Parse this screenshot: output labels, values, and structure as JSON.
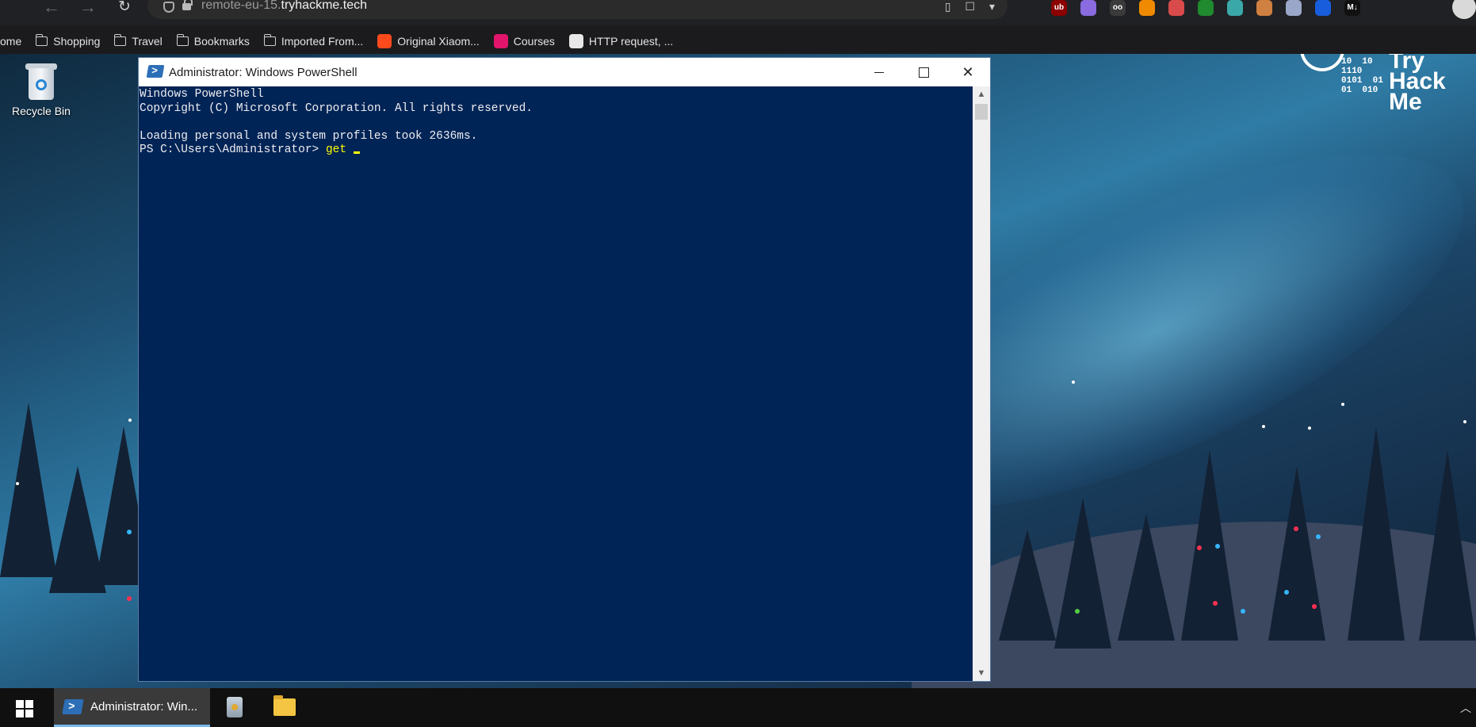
{
  "browser": {
    "url_domain_prefix": "remote-eu-15.",
    "url_domain_main": "tryhackme.tech",
    "bookmarks": [
      {
        "label": "ome",
        "icon": "none"
      },
      {
        "label": "Shopping",
        "icon": "folder-icon"
      },
      {
        "label": "Travel",
        "icon": "folder-icon"
      },
      {
        "label": "Bookmarks",
        "icon": "folder-icon"
      },
      {
        "label": "Imported From...",
        "icon": "folder-icon"
      },
      {
        "label": "Original Xiaom...",
        "icon": "shop-icon",
        "color": "#ff4a1c"
      },
      {
        "label": "Courses",
        "icon": "courses-icon",
        "color": "#e0156b"
      },
      {
        "label": "HTTP request, ...",
        "icon": "chef-icon",
        "color": "#e8e8e8"
      }
    ],
    "extensions": [
      {
        "name": "ublock-icon",
        "text": "ub",
        "color": "#8b0000"
      },
      {
        "name": "puzzle-icon",
        "text": "",
        "color": "#8a6be0"
      },
      {
        "name": "reader-icon",
        "text": "oo",
        "color": "#3a3a3a"
      },
      {
        "name": "wallet-icon",
        "text": "",
        "color": "#f08a00"
      },
      {
        "name": "glasses-icon",
        "text": "",
        "color": "#d94b4b"
      },
      {
        "name": "download-icon",
        "text": "",
        "color": "#1f8a2e"
      },
      {
        "name": "paw-icon",
        "text": "",
        "color": "#3aa8a8"
      },
      {
        "name": "cookie-icon",
        "text": "",
        "color": "#d08040"
      },
      {
        "name": "privacy-icon",
        "text": "",
        "color": "#9aa7c8"
      },
      {
        "name": "bitwarden-icon",
        "text": "",
        "color": "#175ddc"
      },
      {
        "name": "markdown-icon",
        "text": "M↓",
        "color": "#111111"
      }
    ]
  },
  "desktop": {
    "recycle_bin_label": "Recycle Bin",
    "logo_binary": "10  10\n1110\n0101  01\n01  010",
    "logo_text_1": "Try",
    "logo_text_2": "Hack",
    "logo_text_3": "Me"
  },
  "powershell": {
    "title": "Administrator: Windows PowerShell",
    "lines": [
      "Windows PowerShell",
      "Copyright (C) Microsoft Corporation. All rights reserved.",
      "",
      "Loading personal and system profiles took 2636ms."
    ],
    "prompt": "PS C:\\Users\\Administrator> ",
    "command": "get"
  },
  "taskbar": {
    "powershell_label": "Administrator: Win..."
  }
}
